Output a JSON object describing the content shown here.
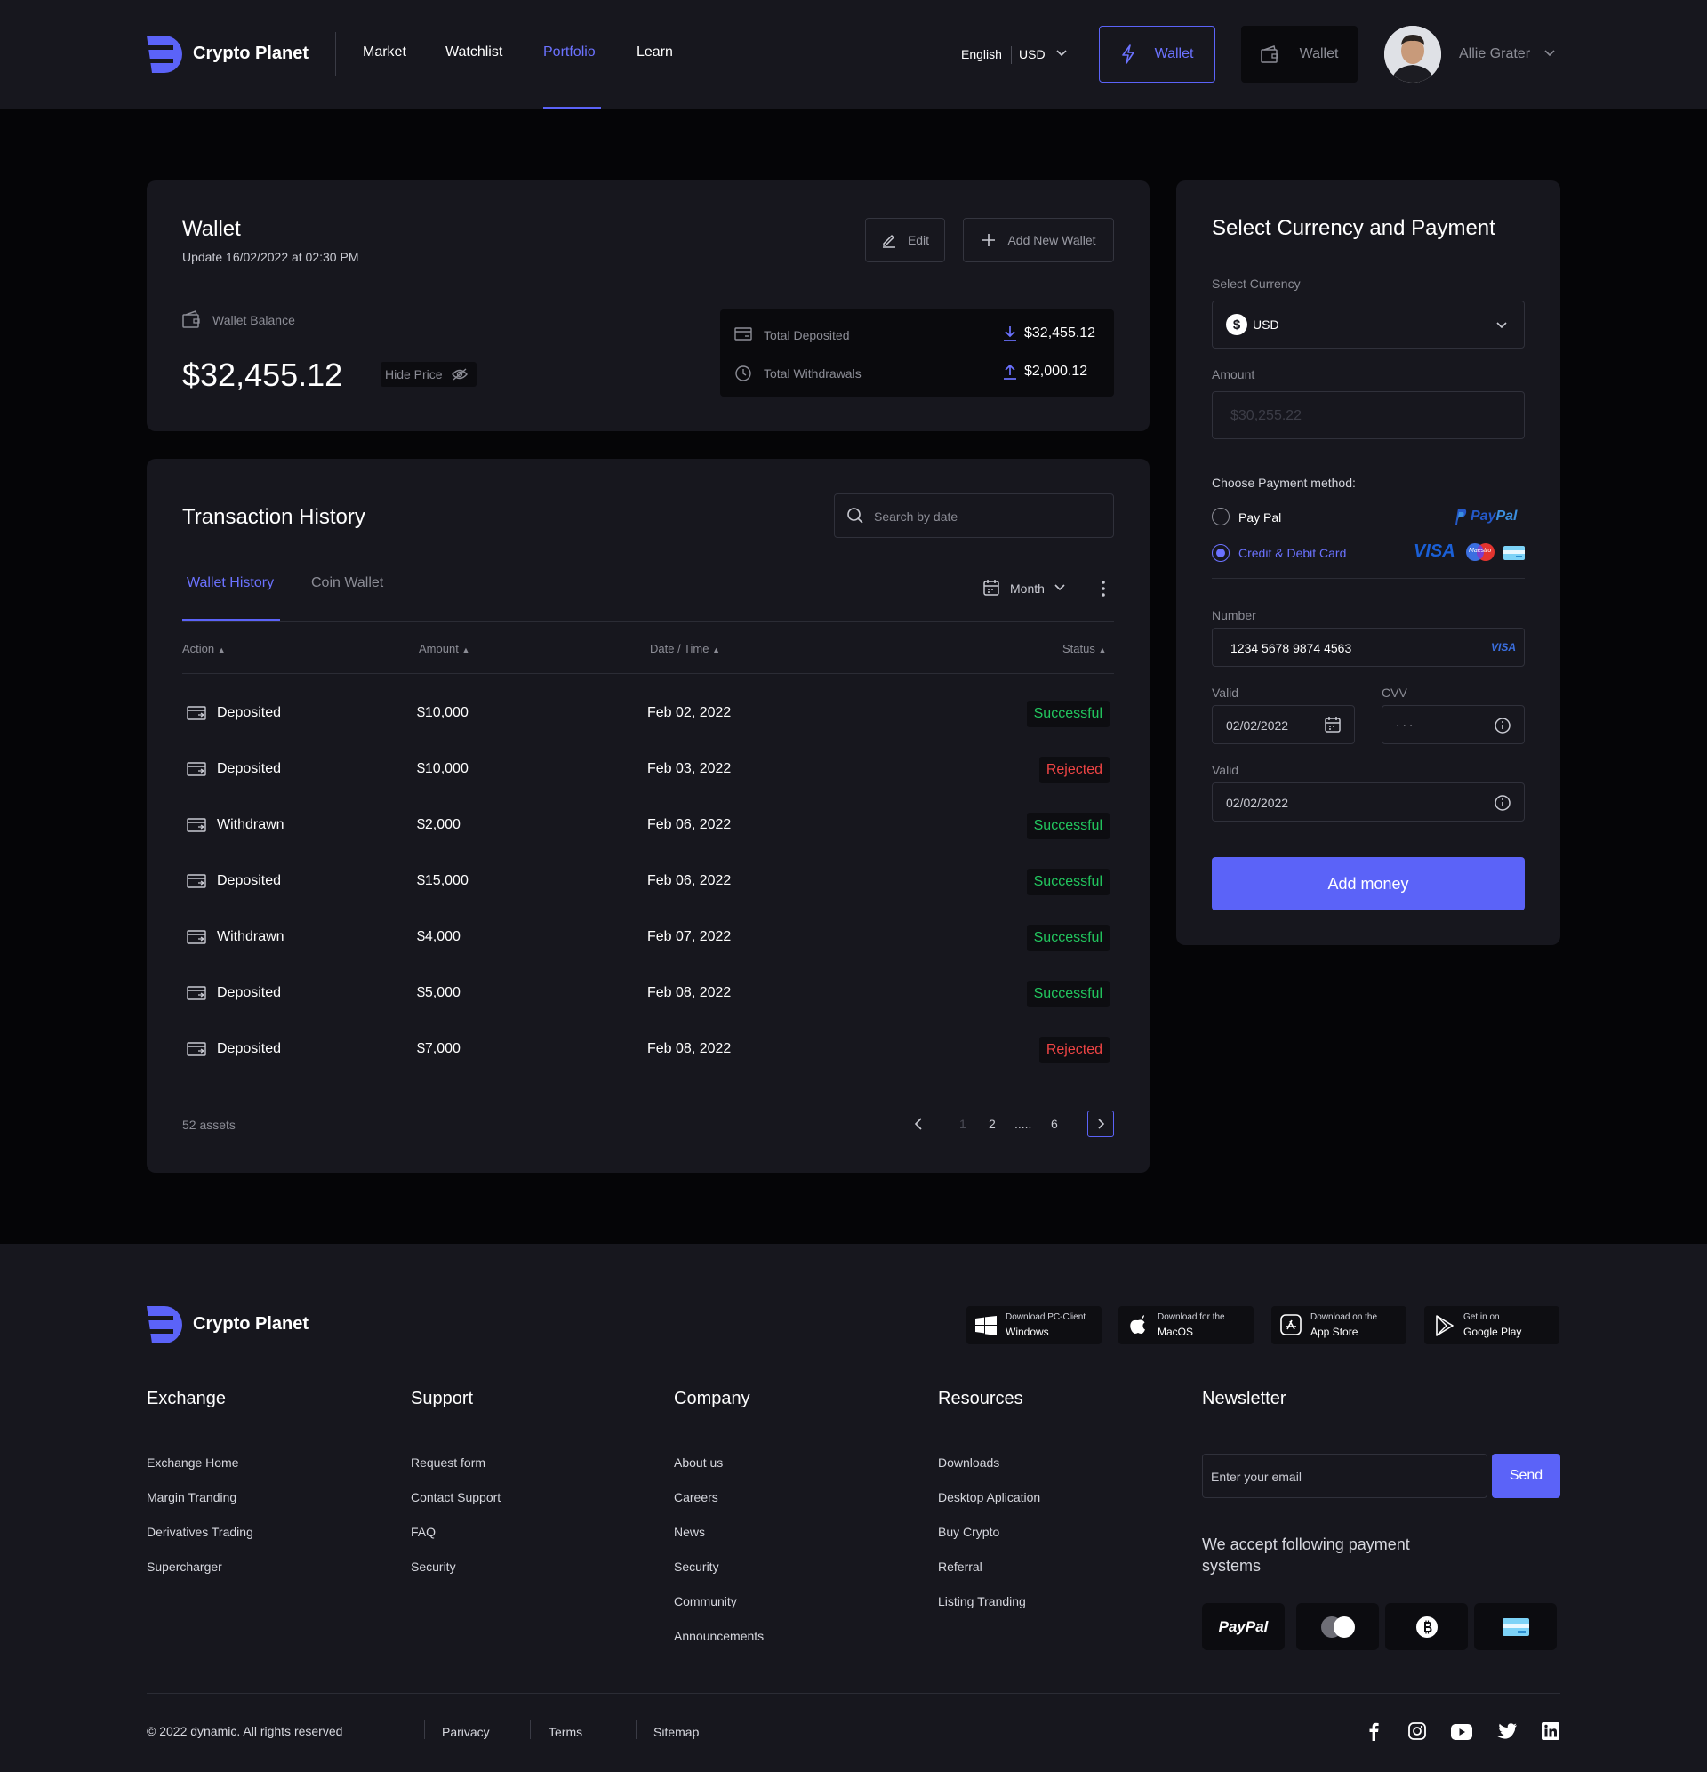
{
  "brand": {
    "name": "Crypto Planet",
    "accent": "#5b63f8"
  },
  "nav": [
    {
      "label": "Market"
    },
    {
      "label": "Watchlist"
    },
    {
      "label": "Portfolio"
    },
    {
      "label": "Learn"
    }
  ],
  "header": {
    "language": "English",
    "currency": "USD",
    "wallet_btn": "Wallet",
    "wallet_btn_2": "Wallet",
    "user_name": "Allie Grater"
  },
  "wallet": {
    "title": "Wallet",
    "updated": "Update 16/02/2022 at 02:30 PM",
    "edit": "Edit",
    "add_new": "Add New Wallet",
    "balance_label": "Wallet Balance",
    "balance": "$32,455.12",
    "hide_price": "Hide Price",
    "total_deposited_label": "Total Deposited",
    "total_deposited": "$32,455.12",
    "total_withdrawals_label": "Total Withdrawals",
    "total_withdrawals": "$2,000.12"
  },
  "transactions": {
    "title": "Transaction History",
    "search_placeholder": "Search by date",
    "tabs": [
      "Wallet History",
      "Coin Wallet"
    ],
    "period": "Month",
    "columns": [
      "Action",
      "Amount",
      "Date / Time",
      "Status"
    ],
    "rows": [
      {
        "action": "Deposited",
        "amount": "$10,000",
        "date": "Feb 02, 2022",
        "status": "Successful"
      },
      {
        "action": "Deposited",
        "amount": "$10,000",
        "date": "Feb 03, 2022",
        "status": "Rejected"
      },
      {
        "action": "Withdrawn",
        "amount": "$2,000",
        "date": "Feb 06, 2022",
        "status": "Successful"
      },
      {
        "action": "Deposited",
        "amount": "$15,000",
        "date": "Feb 06, 2022",
        "status": "Successful"
      },
      {
        "action": "Withdrawn",
        "amount": "$4,000",
        "date": "Feb 07, 2022",
        "status": "Successful"
      },
      {
        "action": "Deposited",
        "amount": "$5,000",
        "date": "Feb 08, 2022",
        "status": "Successful"
      },
      {
        "action": "Deposited",
        "amount": "$7,000",
        "date": "Feb 08, 2022",
        "status": "Rejected"
      }
    ],
    "assets": "52 assets",
    "pages": [
      "1",
      "2",
      ".....",
      "6"
    ]
  },
  "payment": {
    "title": "Select Currency and Payment",
    "select_currency_label": "Select Currency",
    "currency": "USD",
    "amount_label": "Amount",
    "amount_placeholder": "$30,255.22",
    "choose_label": "Choose Payment method:",
    "method_paypal": "Pay Pal",
    "method_card": "Credit & Debit Card",
    "paypal_brand_a": "Pay",
    "paypal_brand_b": "Pal",
    "visa_brand": "VISA",
    "maestro_brand": "Maestro",
    "number_label": "Number",
    "number_value": "1234 5678 9874 4563",
    "number_brand": "VISA",
    "valid_label": "Valid",
    "valid_value": "02/02/2022",
    "cvv_label": "CVV",
    "cvv_value": "...",
    "valid_label_2": "Valid",
    "valid_value_2": "02/02/2022",
    "submit": "Add money"
  },
  "footer": {
    "stores": [
      {
        "small": "Download PC-Client",
        "big": "Windows"
      },
      {
        "small": "Download for the",
        "big": "MacOS"
      },
      {
        "small": "Download on the",
        "big": "App Store"
      },
      {
        "small": "Get in on",
        "big": "Google Play"
      }
    ],
    "columns": [
      {
        "title": "Exchange",
        "links": [
          "Exchange Home",
          "Margin Tranding",
          "Derivatives Trading",
          "Supercharger"
        ]
      },
      {
        "title": "Support",
        "links": [
          "Request form",
          "Contact Support",
          "FAQ",
          "Security"
        ]
      },
      {
        "title": "Company",
        "links": [
          "About us",
          "Careers",
          "News",
          "Security",
          "Community",
          "Announcements"
        ]
      },
      {
        "title": "Resources",
        "links": [
          "Downloads",
          "Desktop Aplication",
          "Buy Crypto",
          "Referral",
          "Listing Tranding"
        ]
      }
    ],
    "newsletter": {
      "title": "Newsletter",
      "placeholder": "Enter your email",
      "send": "Send",
      "payments_text": "We accept following payment systems",
      "paypal": "PayPal"
    },
    "copyright": "© 2022 dynamic. All rights reserved",
    "bottom_links": [
      "Parivacy",
      "Terms",
      "Sitemap"
    ]
  }
}
